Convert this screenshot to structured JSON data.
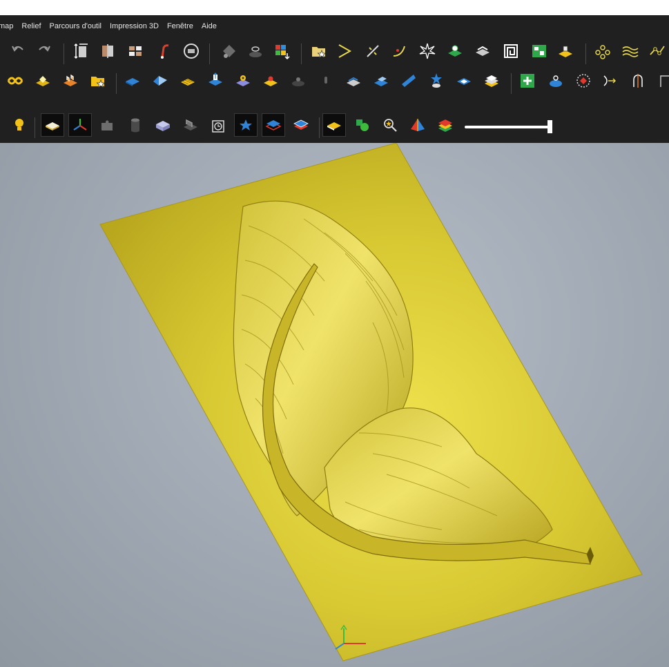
{
  "menubar": {
    "items": [
      "map",
      "Relief",
      "Parcours d'outil",
      "Impression 3D",
      "Fenêtre",
      "Aide"
    ]
  },
  "toolbar_row1": {
    "tools": [
      "undo-icon",
      "redo-icon",
      "resize-icon",
      "split-mirror-icon",
      "tiles-icon",
      "brush-icon",
      "reset-vectors-icon",
      "fill-icon",
      "node-stack-icon",
      "colors-grid-icon",
      "folder-star-icon",
      "chevron-path-icon",
      "wand-icon",
      "curve-icon",
      "starburst-icon",
      "green-disk-icon",
      "stack-layers-icon",
      "maze-icon",
      "green-map-icon",
      "yellow-block-icon",
      "node-circles-icon",
      "wave-lines-icon",
      "polyline-icon"
    ]
  },
  "toolbar_row2": {
    "tools": [
      "weave-icon",
      "yellow-slab-icon",
      "orange-bricks-icon",
      "folder-star-yellow-icon",
      "blue-plate-icon",
      "blue-fold-icon",
      "yellow-stripes-icon",
      "blue-raise-icon",
      "gear-plate-icon",
      "red-button-icon",
      "dark-button-icon",
      "pin-icon",
      "blue-stair-icon",
      "blue-step-icon",
      "blue-slope-icon",
      "blue-star-icon",
      "blue-white-plate-icon",
      "stacked-plates-icon",
      "green-plus-icon",
      "blue-bowl-icon",
      "red-dotted-icon",
      "arrow-in-icon",
      "half-arch-icon",
      "corner-icon"
    ]
  },
  "toolbar_row3": {
    "tools": [
      "light-bulb-icon",
      "shaded-plate-icon",
      "axes-icon",
      "puzzle-icon",
      "cylinder-icon",
      "lavender-box-icon",
      "mesh-tray-icon",
      "clock-icon",
      "blue-star-flat-icon",
      "blue-layer-icon",
      "red-layer-icon",
      "yellow-plate-icon",
      "green-shapes-icon",
      "zoom-star-icon",
      "pyramid-icon",
      "color-stack-icon"
    ],
    "slider_value": 1.0
  },
  "colors": {
    "ui_dark": "#202020",
    "relief_gold": "#cfc02c",
    "viewport_bg": "#a3abb6"
  }
}
